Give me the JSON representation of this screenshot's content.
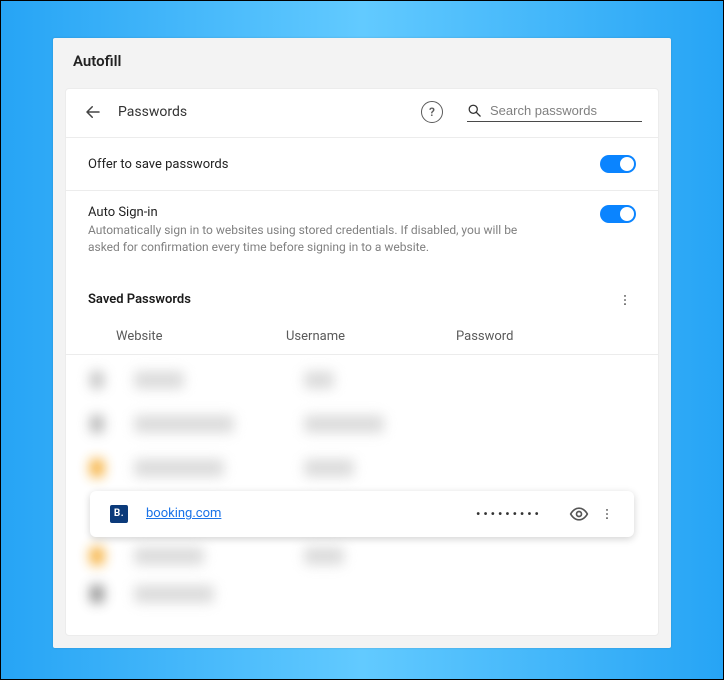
{
  "panel": {
    "title": "Autofill"
  },
  "header": {
    "title": "Passwords"
  },
  "search": {
    "placeholder": "Search passwords",
    "value": ""
  },
  "settings": {
    "offer_save": {
      "label": "Offer to save passwords",
      "enabled": true
    },
    "auto_signin": {
      "label": "Auto Sign-in",
      "description": "Automatically sign in to websites using stored credentials. If disabled, you will be asked for confirmation every time before signing in to a website.",
      "enabled": true
    }
  },
  "saved": {
    "title": "Saved Passwords",
    "columns": {
      "website": "Website",
      "username": "Username",
      "password": "Password"
    }
  },
  "entry": {
    "icon_letter": "B.",
    "website": "booking.com",
    "username": "",
    "password_mask": "•••••••••"
  },
  "colors": {
    "accent": "#0a84ff",
    "link": "#1a73e8"
  }
}
